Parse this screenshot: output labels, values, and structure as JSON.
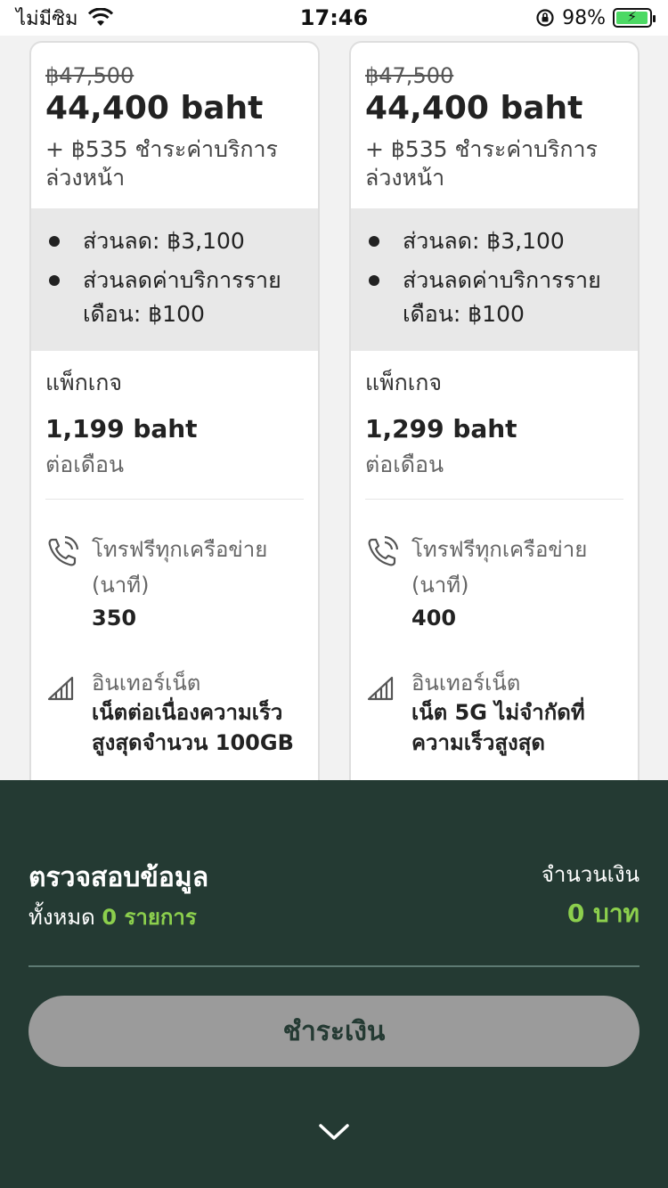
{
  "status_bar": {
    "carrier": "ไม่มีซิม",
    "time": "17:46",
    "battery": "98%",
    "icons": [
      "wifi-icon",
      "rotation-lock-icon",
      "battery-charging-icon"
    ]
  },
  "plans": [
    {
      "old_price": "฿47,500",
      "price": "44,400 baht",
      "advance_fee_line1": "+ ฿535 ชำระค่าบริการ",
      "advance_fee_line2": "ล่วงหน้า",
      "discount_1": "ส่วนลด: ฿3,100",
      "discount_2_line1": "ส่วนลดค่าบริการราย",
      "discount_2_line2": "เดือน: ฿100",
      "package_label": "แพ็กเกจ",
      "package_price": "1,199 baht",
      "per_month": "ต่อเดือน",
      "call_title_line1": "โทรฟรีทุกเครือข่าย",
      "call_title_line2": "(นาที)",
      "call_value": "350",
      "internet_title": "อินเทอร์เน็ต",
      "internet_value_line1": "เน็ตต่อเนื่องความเร็ว",
      "internet_value_line2": "สูงสุดจำนวน 100GB"
    },
    {
      "old_price": "฿47,500",
      "price": "44,400 baht",
      "advance_fee_line1": "+ ฿535 ชำระค่าบริการ",
      "advance_fee_line2": "ล่วงหน้า",
      "discount_1": "ส่วนลด: ฿3,100",
      "discount_2_line1": "ส่วนลดค่าบริการราย",
      "discount_2_line2": "เดือน: ฿100",
      "package_label": "แพ็กเกจ",
      "package_price": "1,299 baht",
      "per_month": "ต่อเดือน",
      "call_title_line1": "โทรฟรีทุกเครือข่าย",
      "call_title_line2": "(นาที)",
      "call_value": "400",
      "internet_title": "อินเทอร์เน็ต",
      "internet_value_line1": "เน็ต 5G ไม่จำกัดที่",
      "internet_value_line2": "ความเร็วสูงสุด"
    }
  ],
  "summary": {
    "title": "ตรวจสอบข้อมูล",
    "total_label": "ทั้งหมด",
    "item_count": "0 รายการ",
    "amount_label": "จำนวนเงิน",
    "amount_value": "0 บาท",
    "pay_button": "ชำระเงิน"
  },
  "colors": {
    "panel_bg": "#243a33",
    "accent_green": "#8ccf4d",
    "pay_button_bg": "#9b9b9b",
    "discount_bg": "#e8e8e8"
  }
}
